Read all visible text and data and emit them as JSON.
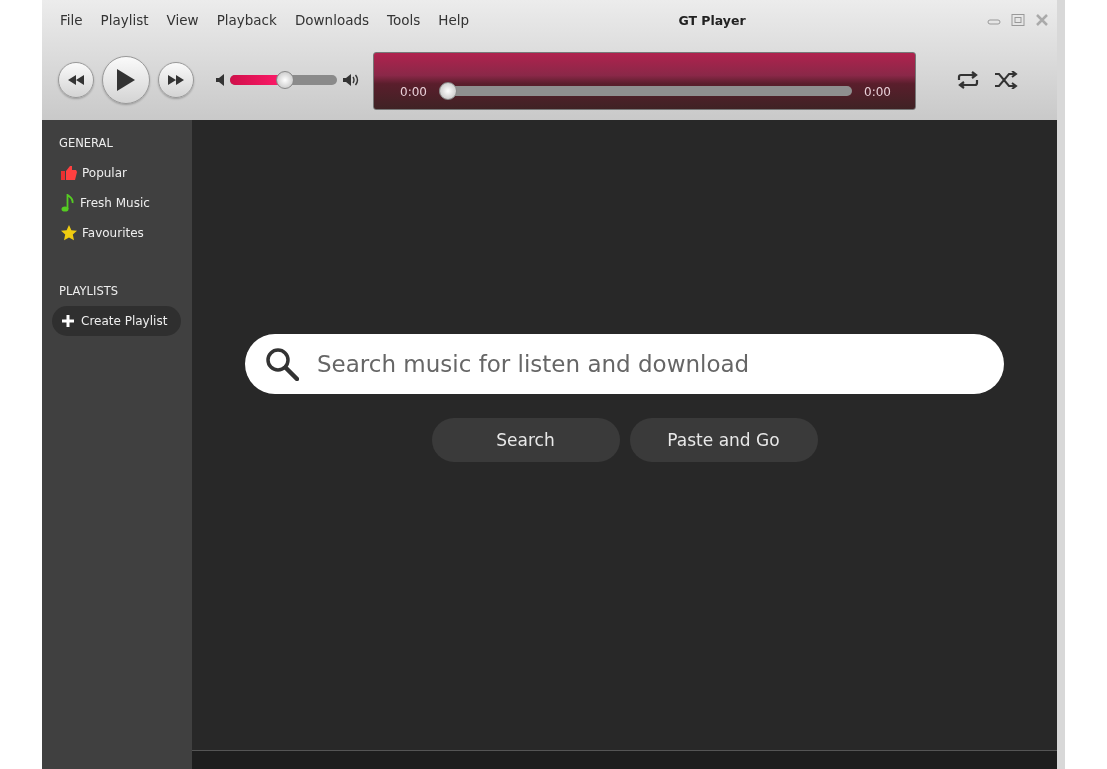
{
  "menu": [
    "File",
    "Playlist",
    "View",
    "Playback",
    "Downloads",
    "Tools",
    "Help"
  ],
  "window": {
    "title": "GT Player"
  },
  "volume": {
    "level": 0.5
  },
  "progress": {
    "elapsed": "0:00",
    "total": "0:00",
    "level": 0
  },
  "sidebar": {
    "sections": [
      {
        "heading": "GENERAL",
        "items": [
          {
            "label": "Popular",
            "kind": "thumb"
          },
          {
            "label": "Fresh Music",
            "kind": "note"
          },
          {
            "label": "Favourites",
            "kind": "star"
          }
        ]
      },
      {
        "heading": "PLAYLISTS",
        "items": [
          {
            "label": "Create Playlist",
            "kind": "add"
          }
        ]
      }
    ]
  },
  "search": {
    "placeholder": "Search music for listen and download"
  },
  "buttons": [
    "Search",
    "Paste and Go"
  ]
}
